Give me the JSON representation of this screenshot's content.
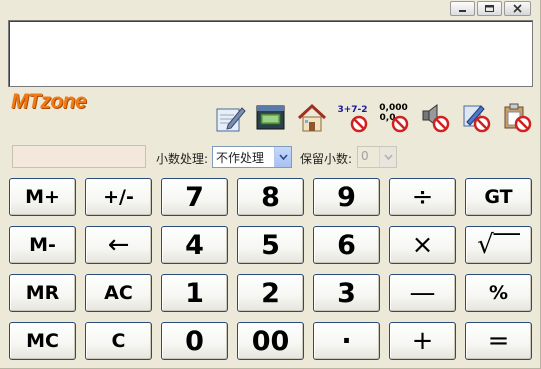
{
  "window": {
    "caption_buttons": [
      {
        "name": "minimize-button",
        "icon": "minimize-icon"
      },
      {
        "name": "restore-button",
        "icon": "restore-icon"
      },
      {
        "name": "close-button",
        "icon": "close-icon"
      }
    ]
  },
  "display": {
    "value": ""
  },
  "logo": {
    "text": "MTzone"
  },
  "toolbar": {
    "items": [
      {
        "name": "notepad-tool",
        "icon": "notepad-pen-icon"
      },
      {
        "name": "cash-tool",
        "icon": "money-window-icon"
      },
      {
        "name": "home-tool",
        "icon": "home-icon"
      },
      {
        "name": "expression-toggle",
        "icon": "expression-off-icon",
        "label": "3+7-2"
      },
      {
        "name": "thousand-separator-toggle",
        "icon": "separator-off-icon",
        "label_top": "0,000",
        "label_bottom": "0,0"
      },
      {
        "name": "sound-toggle",
        "icon": "speaker-off-icon"
      },
      {
        "name": "edit-tool",
        "icon": "clipboard-edit-off-icon"
      },
      {
        "name": "paste-tool",
        "icon": "clipboard-paste-off-icon"
      }
    ]
  },
  "options": {
    "rounding_label": "小数处理:",
    "rounding_value": "不作处理",
    "decimals_label": "保留小数:",
    "decimals_value": "0"
  },
  "keypad": {
    "rows": [
      [
        "M+",
        "+/-",
        "7",
        "8",
        "9",
        "÷",
        "GT"
      ],
      [
        "M-",
        "←",
        "4",
        "5",
        "6",
        "×",
        "√‾‾"
      ],
      [
        "MR",
        "AC",
        "1",
        "2",
        "3",
        "—",
        "%"
      ],
      [
        "MC",
        "C",
        "0",
        "00",
        "·",
        "+",
        "="
      ]
    ]
  },
  "colors": {
    "background": "#ece9d8",
    "logo": "#f07a14",
    "key_border": "#2a4c7a",
    "memo_field": "#f4e8dc"
  }
}
